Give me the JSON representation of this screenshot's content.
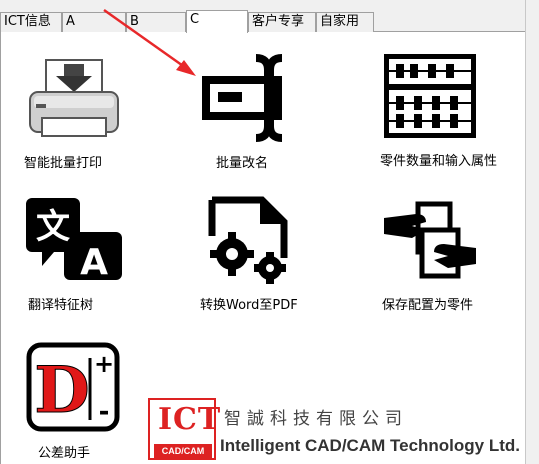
{
  "tabs": [
    {
      "label": "ICT信息",
      "active": false
    },
    {
      "label": "A",
      "active": false
    },
    {
      "label": "B",
      "active": false
    },
    {
      "label": "C",
      "active": true
    },
    {
      "label": "客户专享",
      "active": false
    },
    {
      "label": "自家用",
      "active": false
    }
  ],
  "items": [
    {
      "label": "智能批量打印",
      "icon": "printer-icon"
    },
    {
      "label": "批量改名",
      "icon": "rename-cursor-icon"
    },
    {
      "label": "零件数量和输入属性",
      "icon": "abacus-icon"
    },
    {
      "label": "翻译特征树",
      "icon": "translate-icon"
    },
    {
      "label": "转换Word至PDF",
      "icon": "document-gears-icon"
    },
    {
      "label": "保存配置为零件",
      "icon": "handover-icon"
    },
    {
      "label": "公差助手",
      "icon": "tolerance-d-icon"
    }
  ],
  "icon_glyphs": {
    "translate_a": "文",
    "translate_b": "A",
    "tolerance_d": "D",
    "tolerance_plus": "+",
    "tolerance_minus": "-"
  },
  "logo": {
    "mark": "ICT",
    "sub": "CAD/CAM",
    "chinese": "智誠科技有限公司",
    "english": "Intelligent CAD/CAM Technology Ltd."
  },
  "colors": {
    "accent_red": "#dd2222",
    "arrow_red": "#e8282a"
  }
}
